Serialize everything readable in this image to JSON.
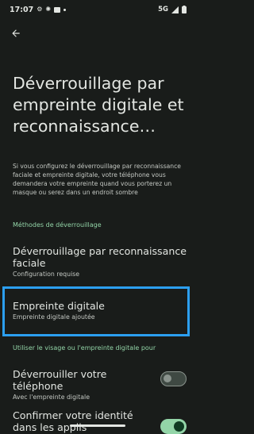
{
  "status_bar": {
    "time": "17:07",
    "network": "5G"
  },
  "header": {
    "title": "Déverrouillage par empreinte digitale et reconnaissance…"
  },
  "description": "Si vous configurez le déverrouillage par reconnais­sance faciale et empreinte digitale, votre téléphone vous demandera votre empreinte quand vous porterez un masque ou serez dans un endroit sombre",
  "sections": {
    "methods_header": "Méthodes de déverrouillage",
    "usage_header": "Utiliser le visage ou l'empreinte digitale pour"
  },
  "methods": {
    "face": {
      "title": "Déverrouillage par reconnaissance faciale",
      "subtitle": "Configuration requise"
    },
    "fingerprint": {
      "title": "Empreinte digitale",
      "subtitle": "Empreinte digitale ajoutée"
    }
  },
  "usage": {
    "unlock": {
      "title": "Déverrouiller votre téléphone",
      "subtitle": "Avec l'empreinte digitale",
      "enabled": false
    },
    "confirm": {
      "title": "Confirmer votre identité dans les applis",
      "enabled": true
    }
  },
  "colors": {
    "background": "#191c1a",
    "accent": "#93d5a8",
    "highlight_border": "#2c9ff0"
  }
}
